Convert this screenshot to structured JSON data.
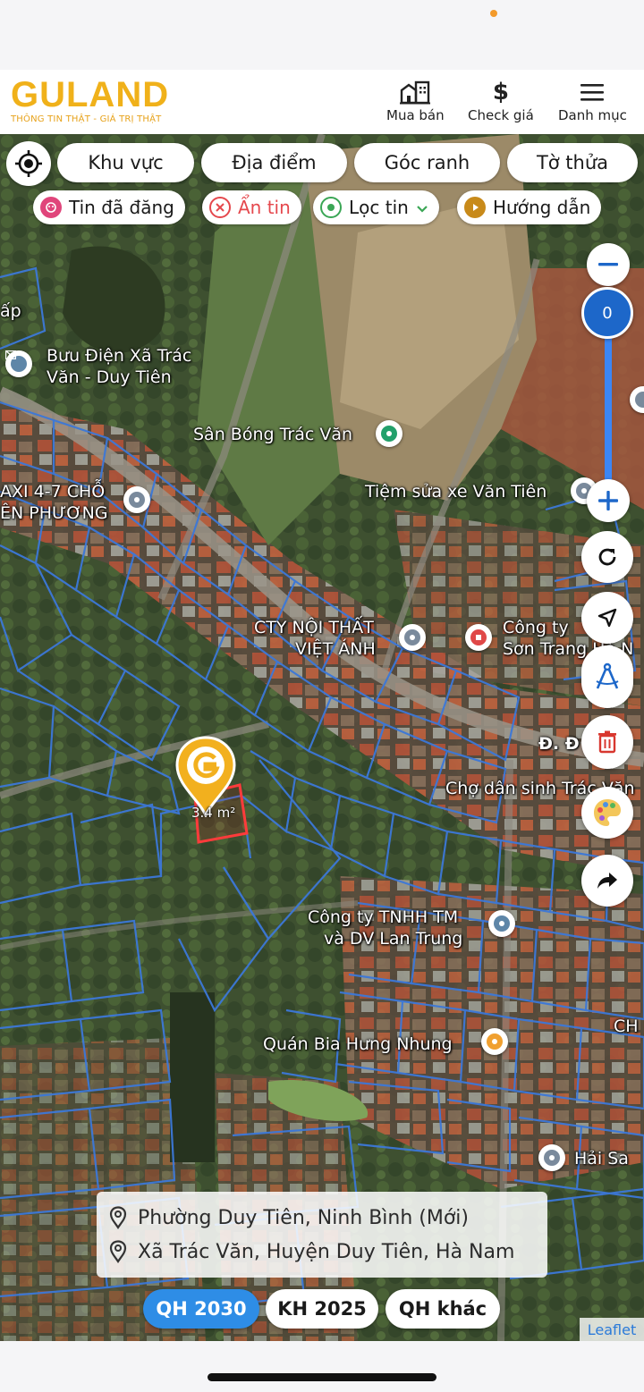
{
  "header": {
    "logo_text": "GULAND",
    "logo_tagline": "THÔNG TIN THẬT - GIÁ TRỊ THẬT",
    "nav": [
      {
        "label": "Mua bán",
        "icon": "building-icon"
      },
      {
        "label": "Check giá",
        "icon": "dollar-icon"
      },
      {
        "label": "Danh mục",
        "icon": "menu-icon"
      }
    ],
    "brand_color": "#f0b11a"
  },
  "filters": {
    "primary": [
      "Khu vực",
      "Địa điểm",
      "Góc ranh",
      "Tờ thửa"
    ],
    "secondary": [
      {
        "label": "Tin đã đăng",
        "icon": "posted-icon",
        "color": "#e0457b"
      },
      {
        "label": "Ẩn tin",
        "icon": "hide-icon",
        "color": "#e5484d"
      },
      {
        "label": "Lọc tin",
        "icon": "filter-pin-icon",
        "color": "#3aa655"
      },
      {
        "label": "Hướng dẫn",
        "icon": "guide-icon",
        "color": "#c88a1a"
      }
    ]
  },
  "map": {
    "places": [
      "Bưu Điện Xã Trác",
      "Văn - Duy Tiên",
      "Sân Bóng Trác Văn",
      "Tiệm sửa xe Văn Tiên",
      "AXI 4-7 CHỖ",
      "ÊN PHƯƠNG",
      "CTY NỘI THẤT",
      "VIỆT ÁNH",
      "Công ty",
      "Sơn Trang Hà N",
      "Đ. Đ",
      "Chợ dân sinh Trác Văn",
      "Công ty TNHH TM",
      "và DV Lan Trung",
      "Quán Bia Hưng Nhung",
      "CH",
      "Hải Sa",
      "ấp"
    ],
    "plot_area": "3.4 m²",
    "zoom_level": "0",
    "attribution": "Leaflet"
  },
  "address": {
    "new": "Phường Duy Tiên, Ninh Bình (Mới)",
    "old": "Xã Trác Văn, Huyện Duy Tiên, Hà Nam"
  },
  "plan_tabs": [
    {
      "label": "QH 2030",
      "active": true
    },
    {
      "label": "KH 2025",
      "active": false
    },
    {
      "label": "QH khác",
      "active": false
    }
  ],
  "accent_color": "#2e8de6"
}
